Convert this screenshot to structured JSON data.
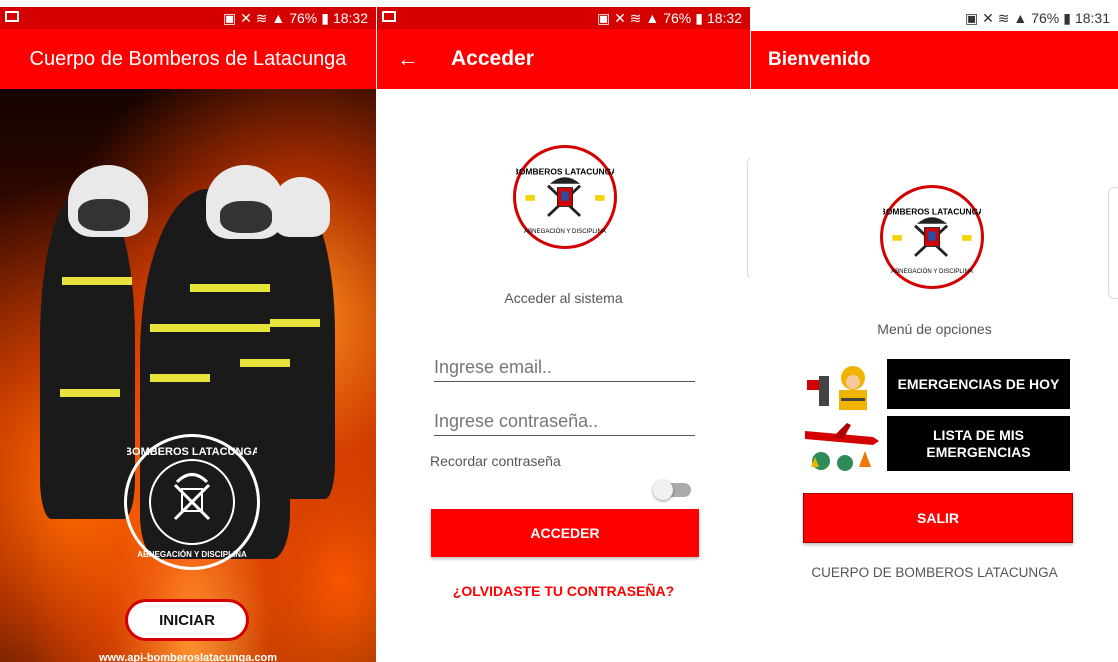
{
  "statusbar": {
    "screen1": {
      "battery": "76%",
      "time": "18:32"
    },
    "screen2": {
      "battery": "76%",
      "time": "18:32"
    },
    "screen3": {
      "battery": "76%",
      "time": "18:31"
    }
  },
  "screen1": {
    "title": "Cuerpo de Bomberos de Latacunga",
    "emblem_text": "BOMBEROS LATACUNGA · ABNEGACIÓN Y DISCIPLINA",
    "start_button": "INICIAR",
    "url": "www.api-bomberoslatacunga.com"
  },
  "screen2": {
    "title": "Acceder",
    "logo_text": "BOMBEROS LATACUNGA · ABNEGACIÓN Y DISCIPLINA",
    "subtitle": "Acceder al sistema",
    "email_placeholder": "Ingrese email..",
    "password_placeholder": "Ingrese contraseña..",
    "remember_label": "Recordar contraseña",
    "remember_on": false,
    "login_button": "ACCEDER",
    "forgot_link": "¿OLVIDASTE TU CONTRASEÑA?"
  },
  "screen3": {
    "title": "Bienvenido",
    "logo_text": "BOMBEROS LATACUNGA · ABNEGACIÓN Y DISCIPLINA",
    "menu_label": "Menú de opciones",
    "today_button": "EMERGENCIAS DE HOY",
    "list_button_line1": "LISTA DE MIS",
    "list_button_line2": "EMERGENCIAS",
    "exit_button": "SALIR",
    "footer": "CUERPO DE BOMBEROS LATACUNGA"
  },
  "colors": {
    "primary": "#ff0000",
    "button_dark": "#000000",
    "status_dark": "#d50000"
  }
}
